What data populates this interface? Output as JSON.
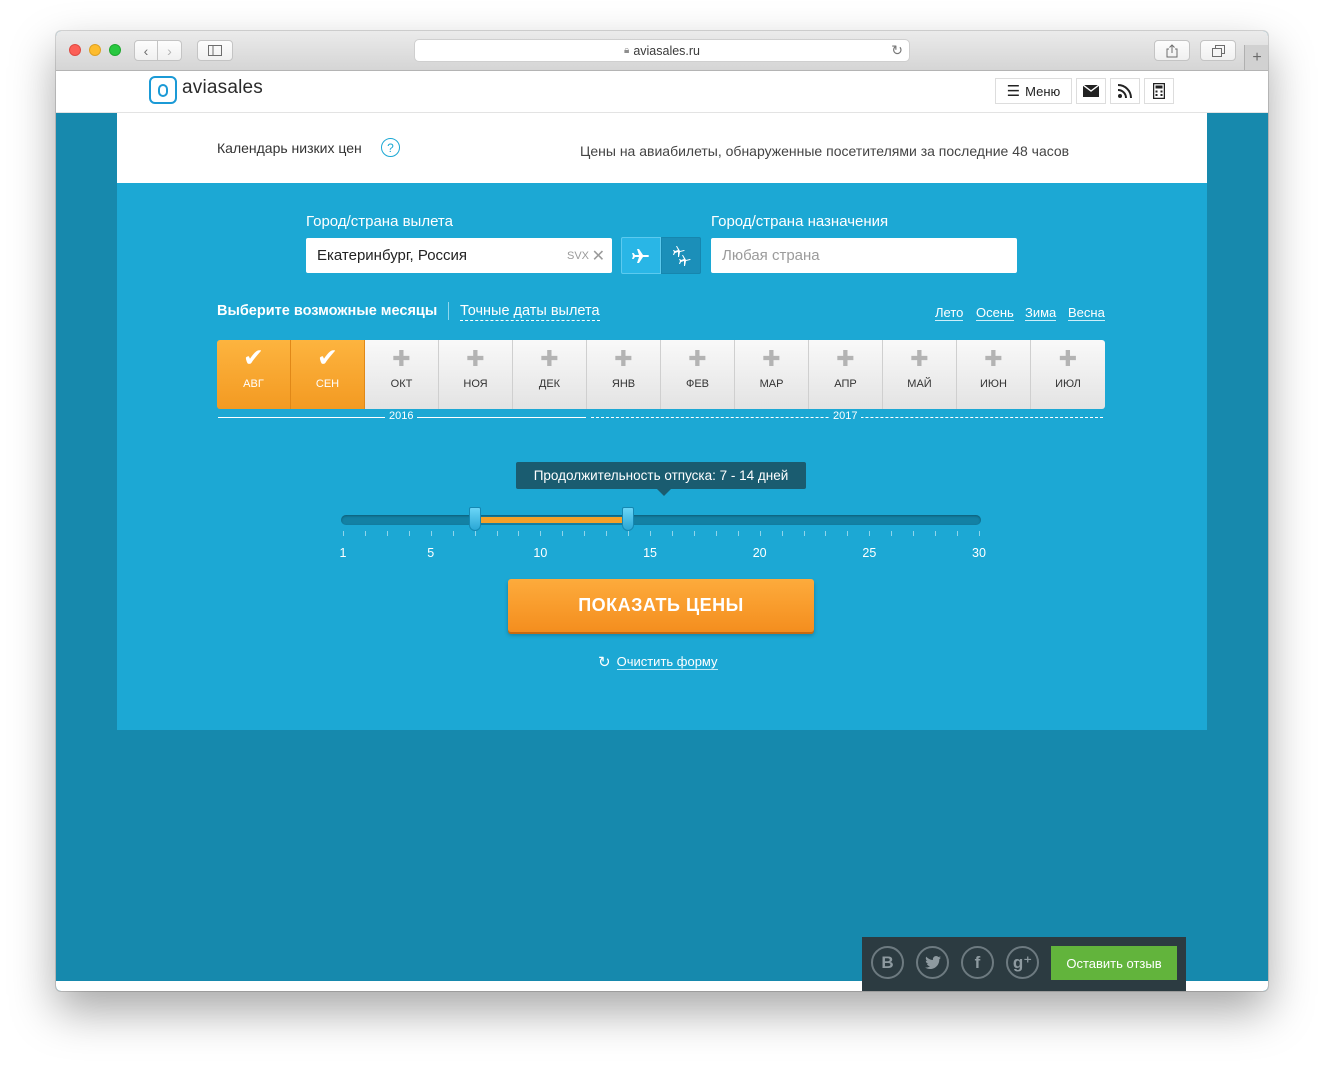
{
  "browser": {
    "url": "aviasales.ru"
  },
  "header": {
    "logo_text": "aviasales",
    "menu_label": "Меню"
  },
  "topbar": {
    "calendar_title": "Календарь низких цен",
    "help_symbol": "?",
    "subtitle": "Цены на авиабилеты, обнаруженные посетителями за последние 48 часов"
  },
  "search": {
    "origin_label": "Город/страна вылета",
    "origin_value": "Екатеринбург, Россия",
    "origin_code": "SVX",
    "destination_label": "Город/страна назначения",
    "destination_placeholder": "Любая страна"
  },
  "months_section": {
    "title": "Выберите возможные месяцы",
    "exact_dates_link": "Точные даты вылета",
    "seasons": [
      "Лето",
      "Осень",
      "Зима",
      "Весна"
    ],
    "months": [
      {
        "label": "АВГ",
        "selected": true
      },
      {
        "label": "СЕН",
        "selected": true
      },
      {
        "label": "ОКТ",
        "selected": false
      },
      {
        "label": "НОЯ",
        "selected": false
      },
      {
        "label": "ДЕК",
        "selected": false
      },
      {
        "label": "ЯНВ",
        "selected": false
      },
      {
        "label": "ФЕВ",
        "selected": false
      },
      {
        "label": "МАР",
        "selected": false
      },
      {
        "label": "АПР",
        "selected": false
      },
      {
        "label": "МАЙ",
        "selected": false
      },
      {
        "label": "ИЮН",
        "selected": false
      },
      {
        "label": "ИЮЛ",
        "selected": false
      }
    ],
    "years": [
      "2016",
      "2017"
    ]
  },
  "duration": {
    "tooltip": "Продолжительность отпуска: 7 - 14 дней",
    "min": 1,
    "max": 30,
    "range_start": 7,
    "range_end": 14,
    "tick_labels": [
      "1",
      "5",
      "10",
      "15",
      "20",
      "25",
      "30"
    ]
  },
  "actions": {
    "show_prices": "ПОКАЗАТЬ ЦЕНЫ",
    "clear_form": "Очистить форму",
    "feedback": "Оставить отзыв"
  },
  "social": [
    "vk-icon",
    "twitter-icon",
    "facebook-icon",
    "google-plus-icon"
  ],
  "colors": {
    "brand_blue": "#1ca8d4",
    "accent_orange": "#f5a028",
    "feedback_green": "#62b43c"
  }
}
